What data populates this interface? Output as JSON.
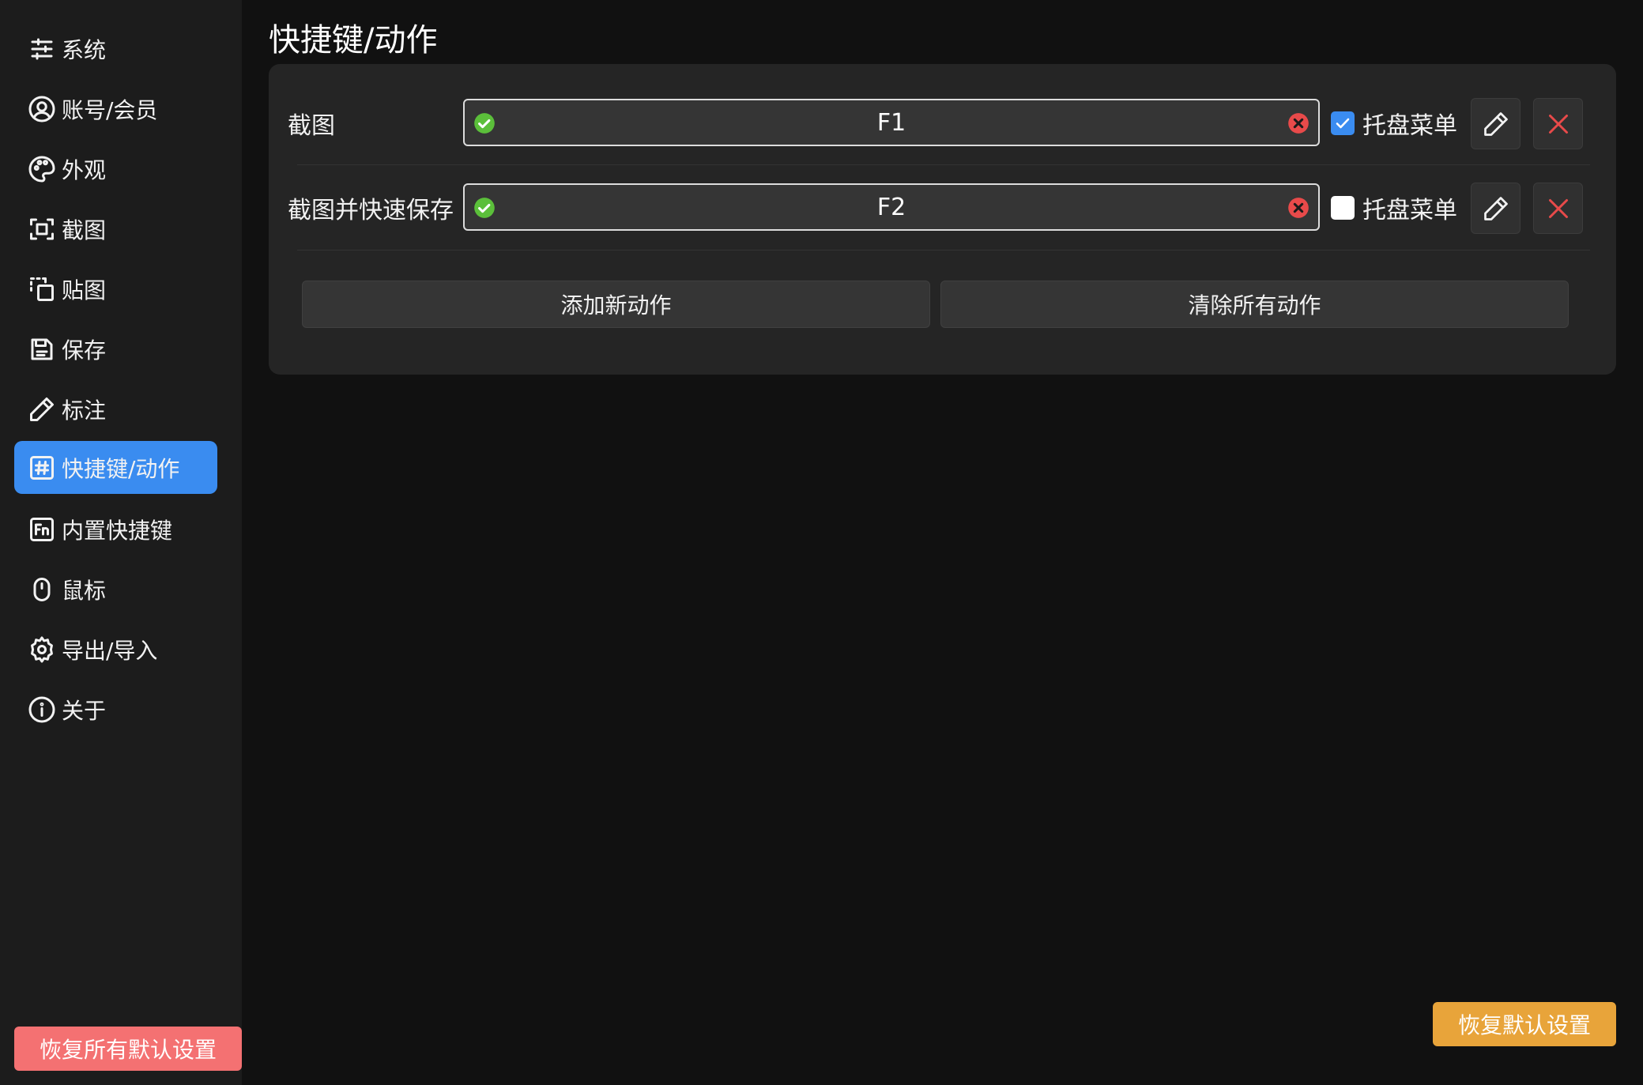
{
  "sidebar": {
    "items": [
      {
        "label": "系统",
        "icon": "sliders-icon",
        "active": false
      },
      {
        "label": "账号/会员",
        "icon": "user-circle-icon",
        "active": false
      },
      {
        "label": "外观",
        "icon": "palette-icon",
        "active": false
      },
      {
        "label": "截图",
        "icon": "screenshot-frame-icon",
        "active": false
      },
      {
        "label": "贴图",
        "icon": "pin-image-icon",
        "active": false
      },
      {
        "label": "保存",
        "icon": "save-icon",
        "active": false
      },
      {
        "label": "标注",
        "icon": "pencil-icon",
        "active": false
      },
      {
        "label": "快捷键/动作",
        "icon": "hash-icon",
        "active": true
      },
      {
        "label": "内置快捷键",
        "icon": "fn-key-icon",
        "active": false
      },
      {
        "label": "鼠标",
        "icon": "mouse-icon",
        "active": false
      },
      {
        "label": "导出/导入",
        "icon": "gear-icon",
        "active": false
      },
      {
        "label": "关于",
        "icon": "info-icon",
        "active": false
      }
    ],
    "reset_all_label": "恢复所有默认设置"
  },
  "main": {
    "title": "快捷键/动作",
    "actions": [
      {
        "name": "截图",
        "hotkey": "F1",
        "tray_menu": true,
        "tray_label": "托盘菜单"
      },
      {
        "name": "截图并快速保存",
        "hotkey": "F2",
        "tray_menu": false,
        "tray_label": "托盘菜单"
      }
    ],
    "add_label": "添加新动作",
    "clear_label": "清除所有动作",
    "reset_default_label": "恢复默认设置"
  },
  "colors": {
    "accent": "#3a8cf0",
    "danger": "#f47172",
    "warning": "#e8a43a",
    "ok": "#5bbf3a",
    "clear": "#e84a4a"
  }
}
